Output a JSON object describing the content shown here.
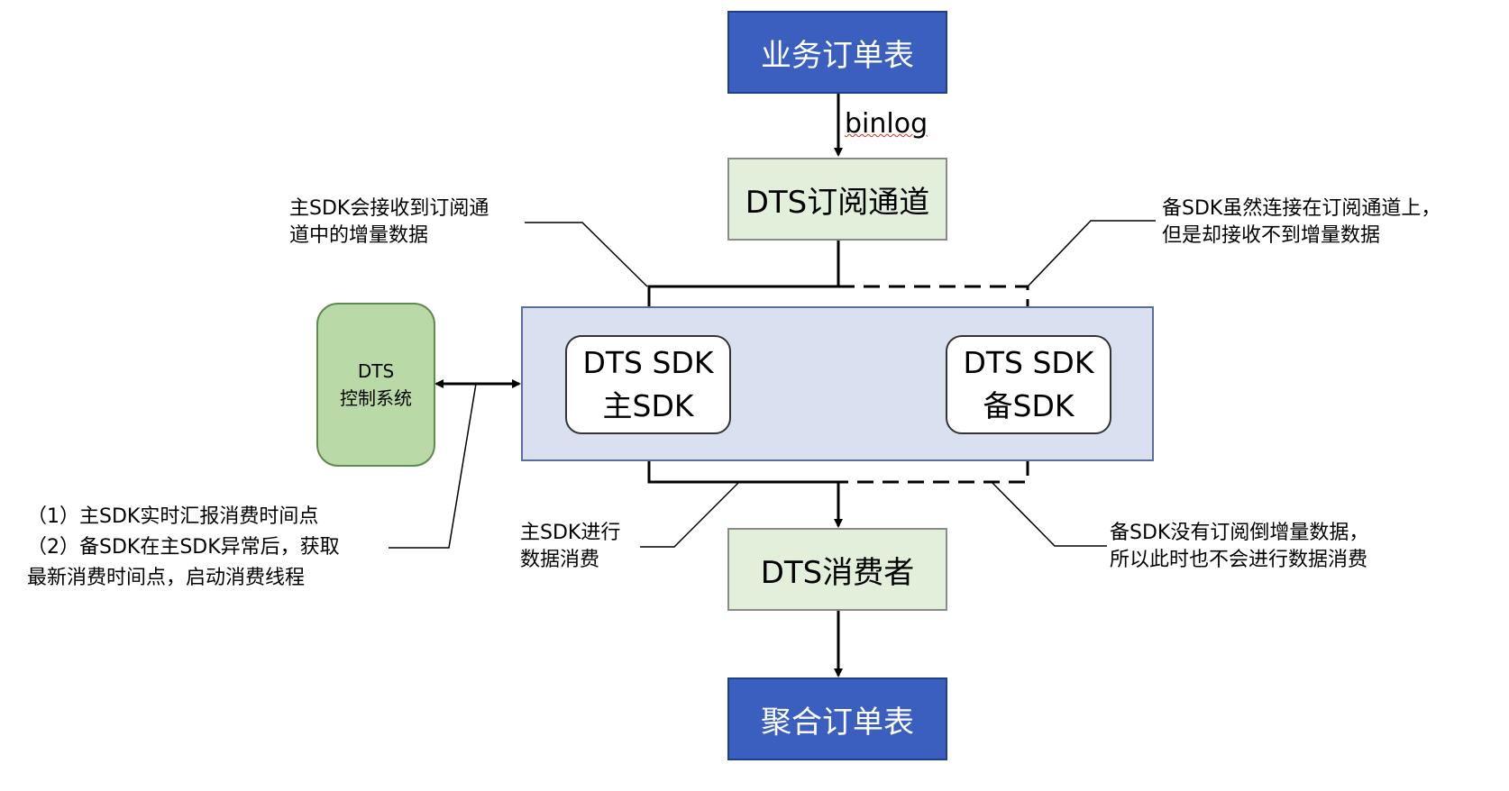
{
  "nodes": {
    "order_table": "业务订单表",
    "dts_channel": "DTS订阅通道",
    "dts_consumer": "DTS消费者",
    "agg_table": "聚合订单表",
    "control_system": [
      "DTS",
      "控制系统"
    ],
    "sdk_primary": [
      "DTS SDK",
      "主SDK"
    ],
    "sdk_backup": [
      "DTS SDK",
      "备SDK"
    ]
  },
  "edge_labels": {
    "binlog": "binlog"
  },
  "notes": {
    "primary_receive": [
      "主SDK会接收到订阅通",
      "道中的增量数据"
    ],
    "backup_connected": [
      "备SDK虽然连接在订阅通道上，",
      "但是却接收不到增量数据"
    ],
    "control_duties": [
      "（1）主SDK实时汇报消费时间点",
      "（2）备SDK在主SDK异常后，获取",
      "最新消费时间点，启动消费线程"
    ],
    "primary_consume": [
      "主SDK进行",
      "数据消费"
    ],
    "backup_no_consume": [
      "备SDK没有订阅倒增量数据，",
      "所以此时也不会进行数据消费"
    ]
  },
  "colors": {
    "blue_node": "#3a5fbe",
    "green_node": "#e2efda",
    "control_node": "#b9d9a6",
    "panel": "#d9e1f1"
  }
}
